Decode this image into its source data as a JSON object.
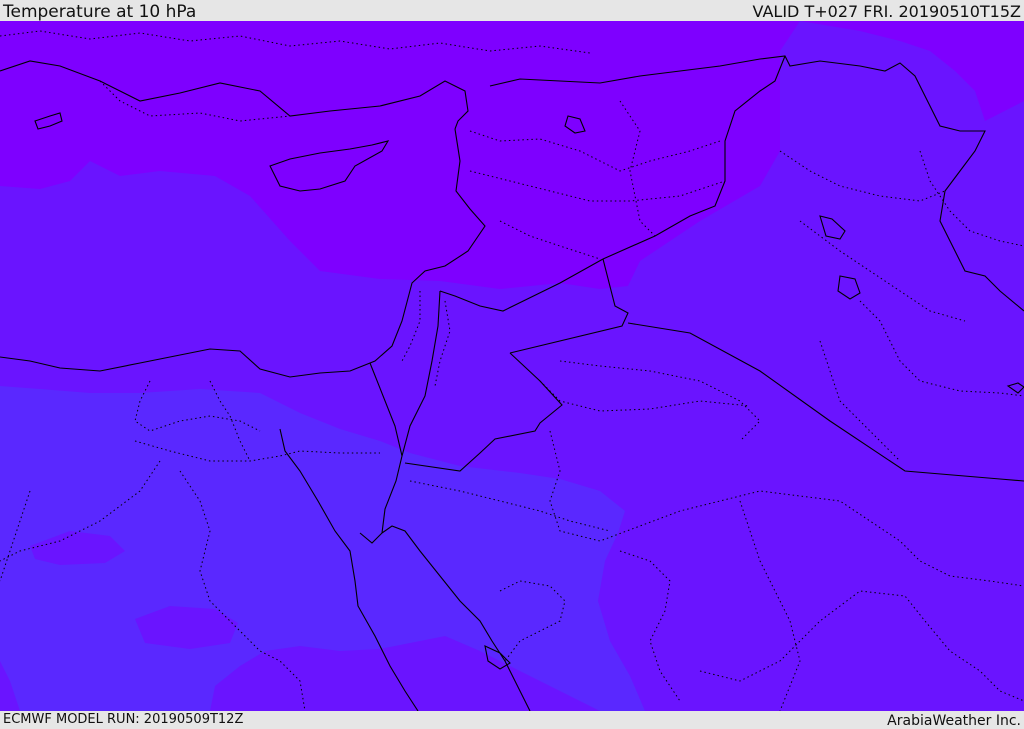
{
  "header": {
    "title": "Temperature at 10 hPa",
    "valid": "VALID T+027 FRI. 20190510T15Z"
  },
  "footer": {
    "model_run": "ECMWF MODEL RUN: 20190509T12Z",
    "credit": "ArabiaWeather Inc."
  },
  "colors": {
    "band_warm": "#7e00ff",
    "band_mid": "#6a14ff",
    "band_cool": "#5a28ff",
    "border_line": "#000000",
    "bar_background": "#e6e6e6"
  }
}
